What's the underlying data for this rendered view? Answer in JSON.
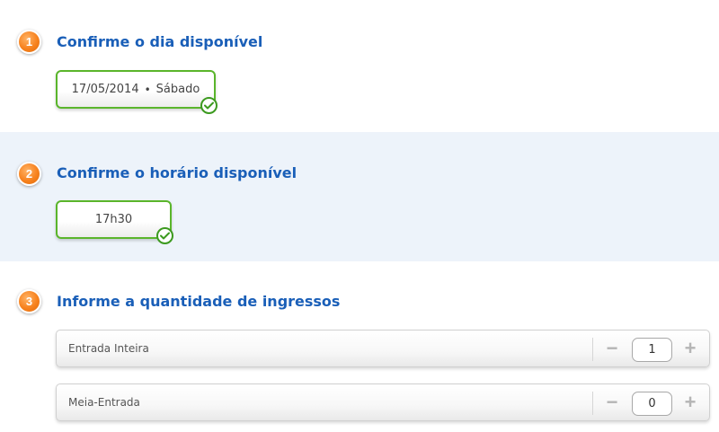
{
  "steps": {
    "day": {
      "number": "1",
      "title": "Confirme o dia disponível",
      "date": "17/05/2014",
      "separator": "•",
      "weekday": "Sábado",
      "confirmed_icon": "check-circle-icon"
    },
    "time": {
      "number": "2",
      "title": "Confirme o horário disponível",
      "time": "17h30",
      "confirmed_icon": "check-circle-icon"
    },
    "tickets": {
      "number": "3",
      "title": "Informe a quantidade de ingressos",
      "rows": [
        {
          "label": "Entrada Inteira",
          "minus": "−",
          "quantity": "1",
          "plus": "+"
        },
        {
          "label": "Meia-Entrada",
          "minus": "−",
          "quantity": "0",
          "plus": "+"
        }
      ]
    }
  },
  "colors": {
    "accent_title": "#1a5fb8",
    "badge_orange": "#f7821e",
    "confirm_green": "#5ab52b",
    "section_highlight": "#edf3fa"
  }
}
